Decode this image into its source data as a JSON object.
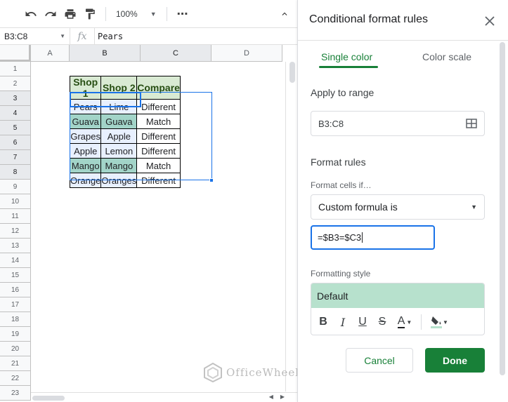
{
  "toolbar": {
    "zoom_label": "100%",
    "more_label": "⋯"
  },
  "formula_bar": {
    "name_box": "B3:C8",
    "fx_label": "fx",
    "formula": "Pears"
  },
  "grid": {
    "columns": [
      "A",
      "B",
      "C",
      "D"
    ],
    "rows": [
      "1",
      "2",
      "3",
      "4",
      "5",
      "6",
      "7",
      "8",
      "9",
      "10",
      "11",
      "12",
      "13",
      "14",
      "15",
      "16",
      "17",
      "18",
      "19",
      "20",
      "21",
      "22",
      "23"
    ],
    "headers": [
      "Shop 1",
      "Shop 2",
      "Compare"
    ],
    "data": [
      [
        "Pears",
        "Lime",
        "Different"
      ],
      [
        "Guava",
        "Guava",
        "Match"
      ],
      [
        "Grapes",
        "Apple",
        "Different"
      ],
      [
        "Apple",
        "Lemon",
        "Different"
      ],
      [
        "Mango",
        "Mango",
        "Match"
      ],
      [
        "Orange",
        "Oranges",
        "Different"
      ]
    ],
    "highlight_color": "#a2d4c8",
    "header_color": "#d9ead3"
  },
  "watermark": "OfficeWheel",
  "panel": {
    "title": "Conditional format rules",
    "tabs": [
      "Single color",
      "Color scale"
    ],
    "apply_label": "Apply to range",
    "range_value": "B3:C8",
    "format_rules_label": "Format rules",
    "format_cells_if_label": "Format cells if…",
    "condition_value": "Custom formula is",
    "formula_value": "=$B3=$C3",
    "formatting_style_label": "Formatting style",
    "style_preview": "Default",
    "style_fill_color": "#b7e1cd",
    "cancel_label": "Cancel",
    "done_label": "Done",
    "accent_color": "#188038"
  }
}
